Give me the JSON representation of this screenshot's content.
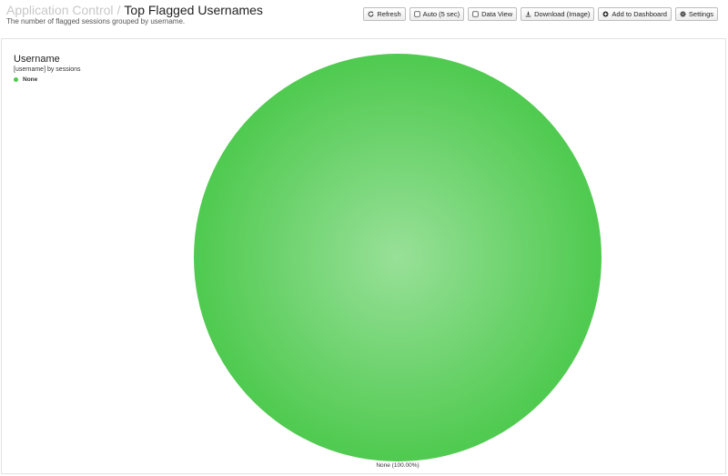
{
  "header": {
    "breadcrumb_parent": "Application Control",
    "breadcrumb_separator": "/",
    "title": "Top Flagged Usernames",
    "subtitle": "The number of flagged sessions grouped by username."
  },
  "toolbar": {
    "refresh_label": "Refresh",
    "auto_label": "Auto (5 sec)",
    "data_view_label": "Data View",
    "download_label": "Download (Image)",
    "add_dashboard_label": "Add to Dashboard",
    "settings_label": "Settings",
    "icons": {
      "refresh": "refresh-icon",
      "auto": "checkbox-icon",
      "data_view": "checkbox-icon",
      "download": "download-icon",
      "add_dashboard": "plus-circle-icon",
      "settings": "gear-icon"
    }
  },
  "chart": {
    "title": "Username",
    "subtitle": "[username] by sessions"
  },
  "chart_data": {
    "type": "pie",
    "title": "Username",
    "subtitle": "[username] by sessions",
    "legend_position": "top-left",
    "slices": [
      {
        "name": "None",
        "value": 100.0,
        "label": "None (100.00%)",
        "color": "#4fca4f",
        "color_center": "#98e098"
      }
    ]
  }
}
